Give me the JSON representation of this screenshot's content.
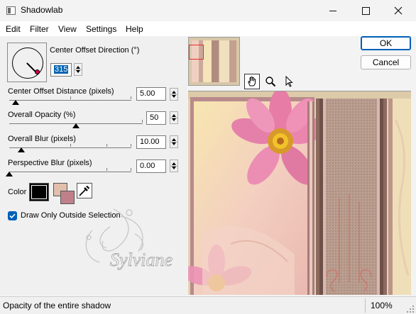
{
  "window": {
    "title": "Shadowlab"
  },
  "menu": [
    "Edit",
    "Filter",
    "View",
    "Settings",
    "Help"
  ],
  "controls": {
    "direction": {
      "label": "Center Offset Direction (°)",
      "value": "315"
    },
    "distance": {
      "label": "Center Offset Distance (pixels)",
      "value": "5.00",
      "level": 0.05
    },
    "opacity": {
      "label": "Overall Opacity (%)",
      "value": "50",
      "level": 0.5
    },
    "blur": {
      "label": "Overall Blur (pixels)",
      "value": "10.00",
      "level": 0.1
    },
    "perspective": {
      "label": "Perspective Blur (pixels)",
      "value": "0.00",
      "level": 0.0
    },
    "color_label": "Color",
    "shadow_color": "#000000",
    "draw_outside": {
      "label": "Draw Only Outside Selection",
      "checked": true
    }
  },
  "buttons": {
    "ok": "OK",
    "cancel": "Cancel"
  },
  "tools": [
    "hand-icon",
    "zoom-icon",
    "pointer-icon"
  ],
  "watermark": "Sylviane",
  "status": {
    "text": "Opacity of the entire shadow",
    "zoom": "100%"
  },
  "colors": {
    "accent": "#005fb8",
    "selection": "#0063b1",
    "dial_dot": "#d2004f"
  }
}
